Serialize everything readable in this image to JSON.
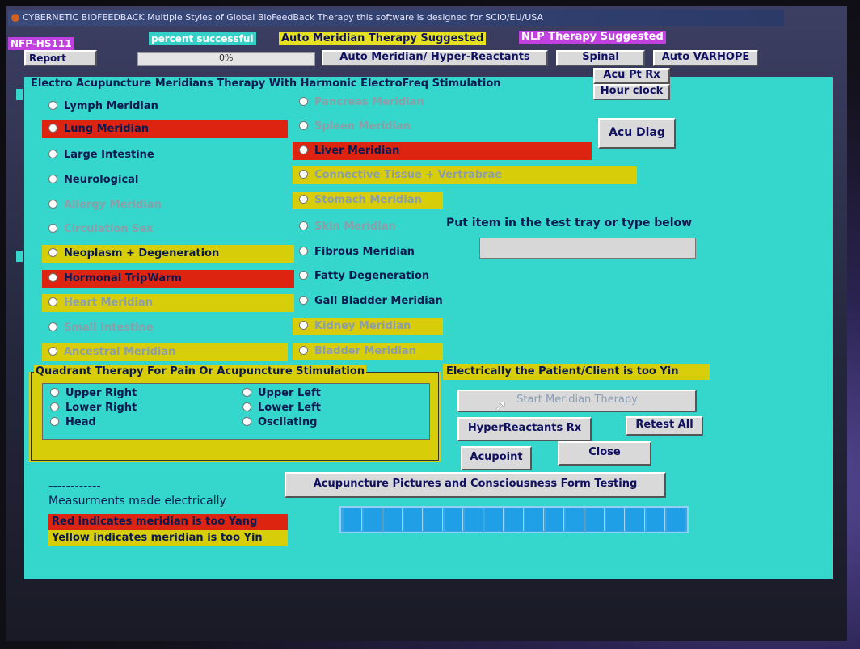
{
  "window": {
    "title": "CYBERNETIC BIOFEEDBACK  Multiple Styles of Global BioFeedBack Therapy  this software is designed for SCIO/EU/USA"
  },
  "topbar": {
    "nfp": "NFP-HS111",
    "percent_successful": "percent successful",
    "auto_meridian_suggested": "Auto Meridian Therapy Suggested",
    "nlp_suggested": "NLP Therapy Suggested",
    "report": "Report",
    "percent_value": "0%",
    "auto_meridian_hyper": "Auto Meridian/ Hyper-Reactants",
    "spinal": "Spinal",
    "auto_varhope": "Auto VARHOPE"
  },
  "panel": {
    "title": "Electro Acupuncture Meridians Therapy With Harmonic ElectroFreq Stimulation",
    "acu_pt_rx": "Acu Pt Rx",
    "hour_clock": "Hour clock",
    "acu_diag": "Acu Diag",
    "left_meridians": [
      {
        "label": "Lymph Meridian",
        "state": "normal"
      },
      {
        "label": "Lung Meridian",
        "state": "red"
      },
      {
        "label": "Large Intestine",
        "state": "normal"
      },
      {
        "label": "Neurological",
        "state": "normal"
      },
      {
        "label": "Allergy Meridian",
        "state": "faint"
      },
      {
        "label": "Circulation Sex",
        "state": "faint"
      },
      {
        "label": "Neoplasm + Degeneration",
        "state": "yellow"
      },
      {
        "label": "Hormonal TripWarm",
        "state": "red"
      },
      {
        "label": "Heart Meridian",
        "state": "yellow-faint"
      },
      {
        "label": "Small Intestine",
        "state": "faint"
      },
      {
        "label": "Ancestral Meridian",
        "state": "yellow-faint"
      }
    ],
    "right_meridians": [
      {
        "label": "Pancreas Meridian",
        "state": "faint"
      },
      {
        "label": "Spleen Meridian",
        "state": "faint"
      },
      {
        "label": "Liver Meridian",
        "state": "red"
      },
      {
        "label": "Connective Tissue + Vertrabrae",
        "state": "yellow-faint"
      },
      {
        "label": "Stomach Meridian",
        "state": "yellow-faint"
      },
      {
        "label": "Skin Meridian",
        "state": "faint"
      },
      {
        "label": "Fibrous Meridian",
        "state": "normal"
      },
      {
        "label": "Fatty Degeneration",
        "state": "normal"
      },
      {
        "label": "Gall Bladder Meridian",
        "state": "normal"
      },
      {
        "label": "Kidney Meridian",
        "state": "yellow-faint"
      },
      {
        "label": "Bladder Meridian",
        "state": "yellow-faint"
      }
    ],
    "test_prompt": "Put item in the test tray or type below",
    "test_input_value": "",
    "quadrant": {
      "title": "Quadrant Therapy For Pain Or Acupuncture Stimulation",
      "left": [
        "Upper Right",
        "Lower Right",
        "Head"
      ],
      "right": [
        "Upper Left",
        "Lower Left",
        "Oscilating"
      ]
    },
    "status_yin": "Electrically the Patient/Client is too Yin",
    "start_meridian_therapy": "Start Meridian Therapy",
    "hyperreactants_rx": "HyperReactants Rx",
    "retest_all": "Retest All",
    "acupoint": "Acupoint",
    "close": "Close",
    "pictures_button": "Acupuncture Pictures and Consciousness Form Testing",
    "legend": {
      "dashes": "------------",
      "measurements": "Measurments made electrically",
      "red_text": "Red indicates meridian is too Yang",
      "yellow_text": "Yellow indicates meridian is too Yin",
      "red_color": "#dd2410",
      "yellow_color": "#d7cd09"
    },
    "progress": {
      "value_fraction": 1.0,
      "segments": 17
    }
  }
}
